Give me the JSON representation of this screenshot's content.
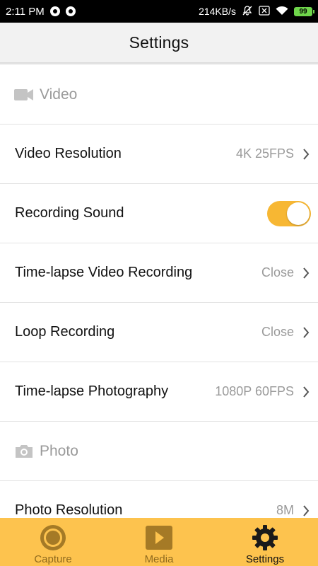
{
  "status_bar": {
    "time": "2:11 PM",
    "speed": "214KB/s",
    "battery": "99"
  },
  "header": {
    "title": "Settings"
  },
  "sections": {
    "video": {
      "label": "Video",
      "icon": "video-camera-icon",
      "rows": [
        {
          "label": "Video Resolution",
          "value": "4K 25FPS"
        },
        {
          "label": "Recording Sound",
          "toggle": true
        },
        {
          "label": "Time-lapse Video Recording",
          "value": "Close"
        },
        {
          "label": "Loop Recording",
          "value": "Close"
        },
        {
          "label": "Time-lapse Photography",
          "value": "1080P 60FPS"
        }
      ]
    },
    "photo": {
      "label": "Photo",
      "icon": "camera-icon",
      "rows": [
        {
          "label": "Photo Resolution",
          "value": "8M"
        }
      ]
    }
  },
  "bottom_nav": {
    "items": [
      {
        "label": "Capture",
        "icon": "capture-icon"
      },
      {
        "label": "Media",
        "icon": "media-play-icon"
      },
      {
        "label": "Settings",
        "icon": "gear-icon",
        "active": true
      }
    ]
  },
  "colors": {
    "accent": "#fdc34e",
    "toggle_on": "#f7b733",
    "secondary_text": "#9a9a9a"
  }
}
